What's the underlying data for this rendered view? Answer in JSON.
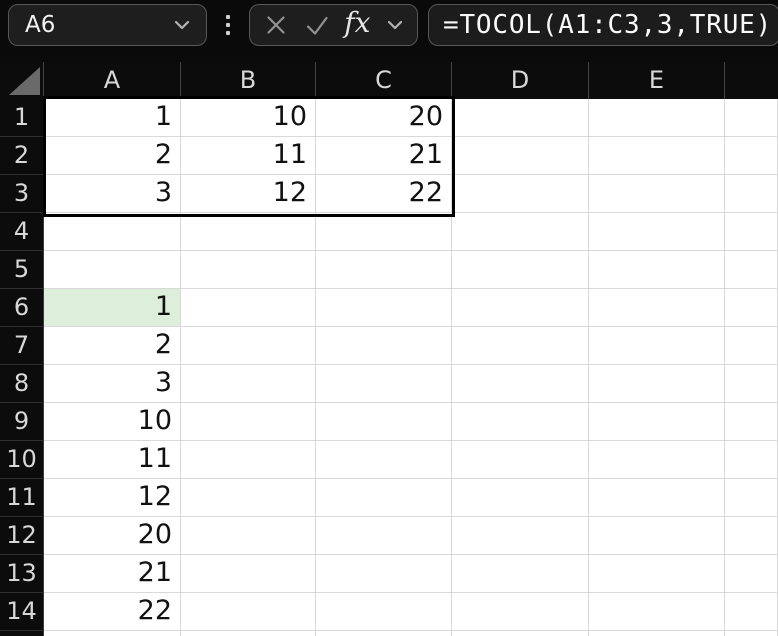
{
  "topbar": {
    "name_box": {
      "value": "A6"
    },
    "formula_bar": {
      "value": "=TOCOL(A1:C3,3,TRUE)"
    },
    "insert_function_label": "fx"
  },
  "sheet": {
    "columns": [
      "A",
      "B",
      "C",
      "D",
      "E"
    ],
    "partial_column_label": "",
    "rows": [
      "1",
      "2",
      "3",
      "4",
      "5",
      "6",
      "7",
      "8",
      "9",
      "10",
      "11",
      "12",
      "13",
      "14"
    ],
    "cells": {
      "A1": "1",
      "B1": "10",
      "C1": "20",
      "A2": "2",
      "B2": "11",
      "C2": "21",
      "A3": "3",
      "B3": "12",
      "C3": "22",
      "A6": "1",
      "A7": "2",
      "A8": "3",
      "A9": "10",
      "A10": "11",
      "A11": "12",
      "A12": "20",
      "A13": "21",
      "A14": "22"
    },
    "active_cell": "A6",
    "bordered_range": "A1:C3",
    "colors": {
      "active_cell_fill": "#ddefda",
      "grid_line": "#d9d9d9",
      "range_border": "#000000",
      "header_text": "#d8d8d8",
      "cell_text": "#111111"
    }
  }
}
